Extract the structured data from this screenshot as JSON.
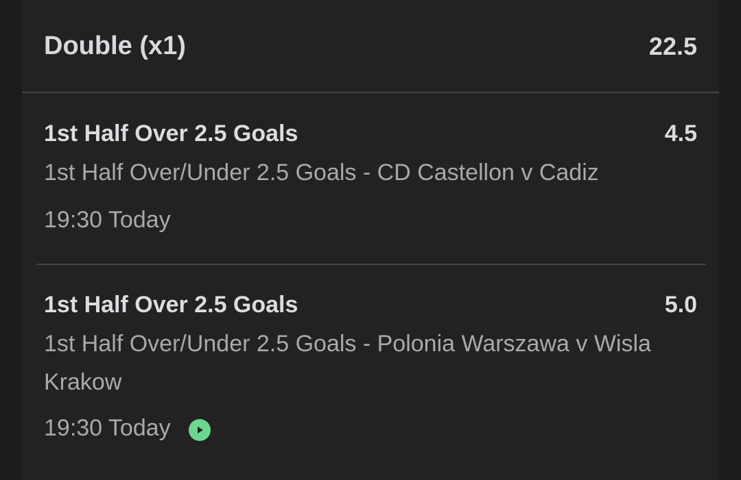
{
  "bet": {
    "title": "Double (x1)",
    "odds": "22.5"
  },
  "legs": [
    {
      "selection": "1st Half Over 2.5 Goals",
      "odds": "4.5",
      "market_event": "1st Half Over/Under 2.5 Goals - CD Castellon v Cadiz",
      "time": "19:30 Today"
    },
    {
      "selection": "1st Half Over 2.5 Goals",
      "odds": "5.0",
      "market_event": "1st Half Over/Under 2.5 Goals - Polonia Warszawa v Wisla Krakow",
      "time": "19:30 Today",
      "icon": "live-stream-play-icon"
    }
  ],
  "colors": {
    "background": "#1c1c1c",
    "card": "#222222",
    "live_icon": "#6bd88f"
  }
}
